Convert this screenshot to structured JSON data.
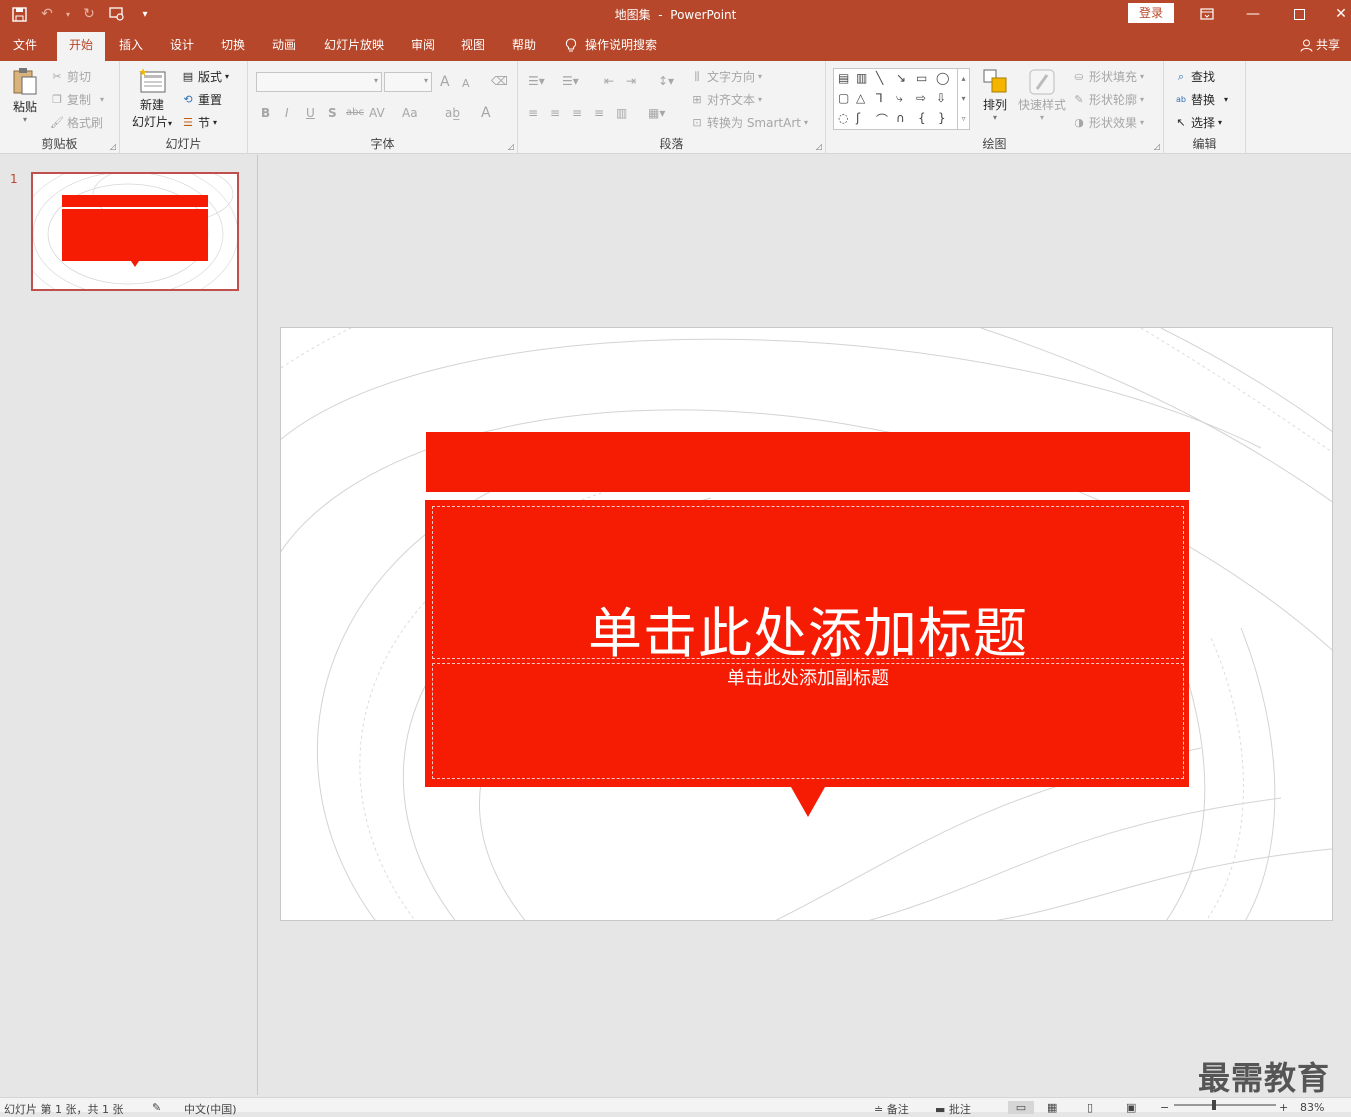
{
  "window": {
    "doc_title": "地图集",
    "app_name": "PowerPoint",
    "login_label": "登录"
  },
  "tabs": [
    "文件",
    "开始",
    "插入",
    "设计",
    "切换",
    "动画",
    "幻灯片放映",
    "审阅",
    "视图",
    "帮助"
  ],
  "active_tab": "开始",
  "tellme_label": "操作说明搜索",
  "share_label": "共享",
  "ribbon": {
    "clipboard": {
      "label": "剪贴板",
      "paste": "粘贴",
      "cut": "剪切",
      "copy": "复制",
      "format_painter": "格式刷"
    },
    "slides": {
      "label": "幻灯片",
      "new_slide_line1": "新建",
      "new_slide_line2": "幻灯片",
      "layout": "版式",
      "reset": "重置",
      "section": "节"
    },
    "font": {
      "label": "字体",
      "bold": "B",
      "italic": "I",
      "underline": "U",
      "shadow": "S",
      "strike": "abc",
      "spacing": "AV",
      "case": "Aa",
      "grow": "A",
      "shrink": "A",
      "font_color": "A"
    },
    "paragraph": {
      "label": "段落",
      "text_direction": "文字方向",
      "align_text": "对齐文本",
      "smartart": "转换为 SmartArt"
    },
    "drawing": {
      "label": "绘图",
      "arrange": "排列",
      "quick_styles": "快速样式",
      "shape_fill": "形状填充",
      "shape_outline": "形状轮廓",
      "shape_effects": "形状效果"
    },
    "editing": {
      "label": "编辑",
      "find": "查找",
      "replace": "替换",
      "select": "选择"
    }
  },
  "thumbnail": {
    "number": "1"
  },
  "slide": {
    "title_placeholder": "单击此处添加标题",
    "subtitle_placeholder": "单击此处添加副标题"
  },
  "statusbar": {
    "slide_info": "幻灯片 第 1 张，共 1 张",
    "language": "中文(中国)",
    "notes": "备注",
    "comments": "批注",
    "zoom": "83%"
  },
  "watermark": "最需教育",
  "colors": {
    "accent": "#b7472a",
    "slide_red": "#f61c04"
  }
}
